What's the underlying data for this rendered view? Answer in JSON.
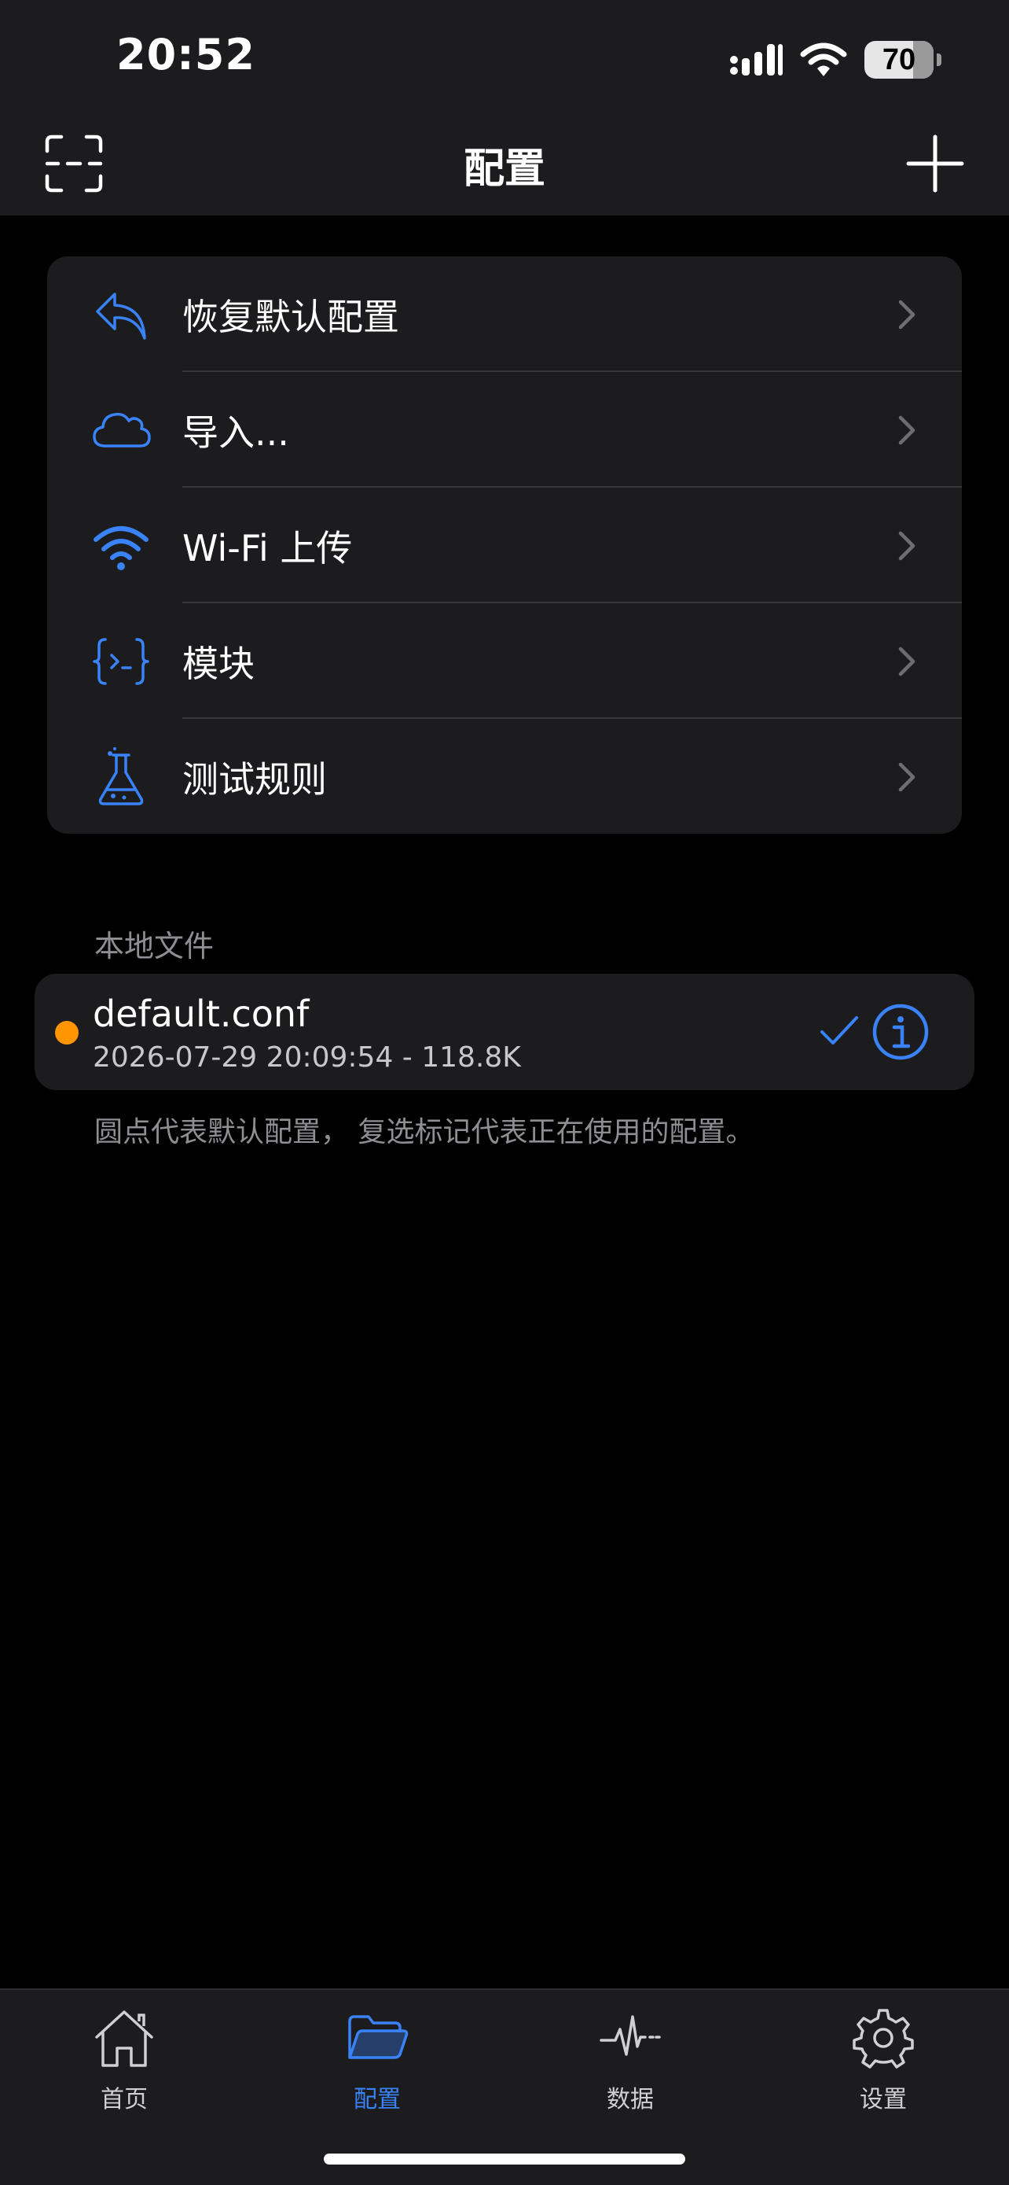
{
  "status_bar": {
    "time": "20:52",
    "battery": "70"
  },
  "nav": {
    "title": "配置",
    "scan_icon": "scan-icon",
    "add_icon": "plus-icon"
  },
  "menu": {
    "items": [
      {
        "label": "恢复默认配置",
        "icon": "undo-arrow-icon"
      },
      {
        "label": "导入...",
        "icon": "cloud-icon"
      },
      {
        "label": "Wi-Fi 上传",
        "icon": "wifi-icon"
      },
      {
        "label": "模块",
        "icon": "code-braces-icon"
      },
      {
        "label": "测试规则",
        "icon": "flask-icon"
      }
    ]
  },
  "local_files": {
    "section_title": "本地文件",
    "files": [
      {
        "name": "default.conf",
        "meta": "2026-07-29 20:09:54 - 118.8K",
        "default": true,
        "active": true
      }
    ],
    "footnote": "圆点代表默认配置， 复选标记代表正在使用的配置。"
  },
  "tabbar": {
    "tabs": [
      {
        "label": "首页",
        "icon": "home-icon",
        "active": false
      },
      {
        "label": "配置",
        "icon": "folder-icon",
        "active": true
      },
      {
        "label": "数据",
        "icon": "activity-icon",
        "active": false
      },
      {
        "label": "设置",
        "icon": "gear-icon",
        "active": false
      }
    ]
  },
  "colors": {
    "accent": "#3a82f7",
    "default_dot": "#ff9500",
    "card_bg": "#1c1c1e",
    "background": "#000000"
  }
}
